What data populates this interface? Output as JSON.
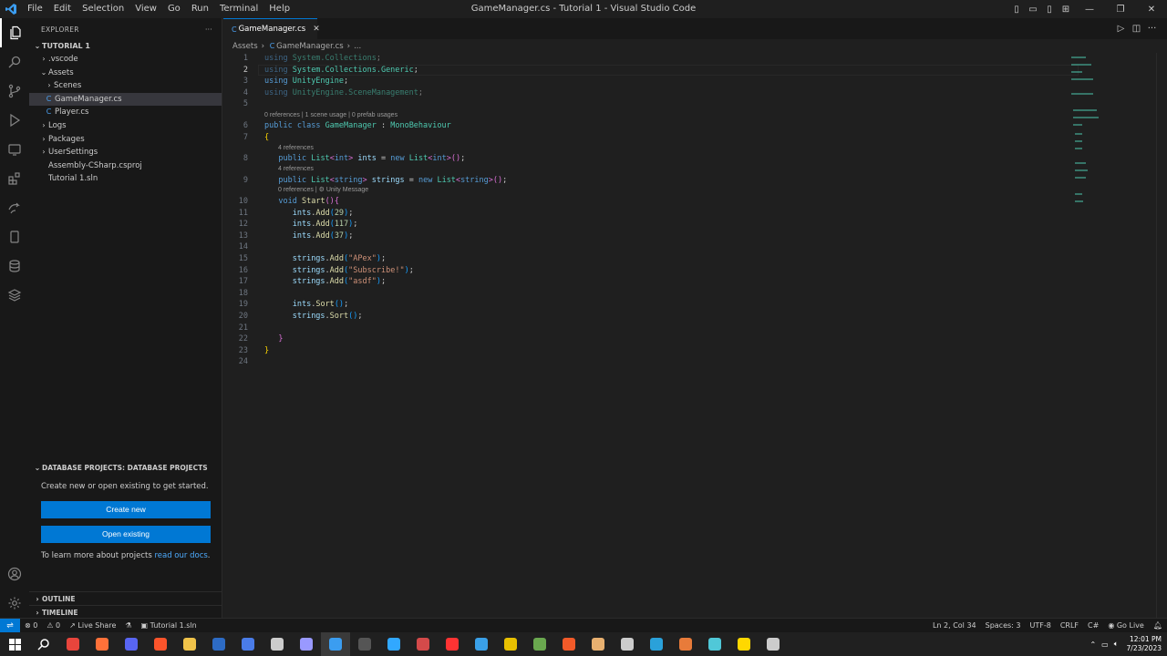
{
  "titlebar": {
    "menu": [
      "File",
      "Edit",
      "Selection",
      "View",
      "Go",
      "Run",
      "Terminal",
      "Help"
    ],
    "title": "GameManager.cs - Tutorial 1 - Visual Studio Code"
  },
  "explorer": {
    "header": "EXPLORER",
    "more": "···",
    "root": "TUTORIAL 1",
    "items": [
      {
        "label": ".vscode",
        "kind": "folder",
        "depth": 1
      },
      {
        "label": "Assets",
        "kind": "folder-open",
        "depth": 1
      },
      {
        "label": "Scenes",
        "kind": "folder",
        "depth": 2
      },
      {
        "label": "GameManager.cs",
        "kind": "cs",
        "depth": 2,
        "selected": true
      },
      {
        "label": "Player.cs",
        "kind": "cs",
        "depth": 2
      },
      {
        "label": "Logs",
        "kind": "folder",
        "depth": 1
      },
      {
        "label": "Packages",
        "kind": "folder",
        "depth": 1
      },
      {
        "label": "UserSettings",
        "kind": "folder",
        "depth": 1
      },
      {
        "label": "Assembly-CSharp.csproj",
        "kind": "file",
        "depth": 1
      },
      {
        "label": "Tutorial 1.sln",
        "kind": "file",
        "depth": 1
      }
    ]
  },
  "dbprojects": {
    "header": "DATABASE PROJECTS: DATABASE PROJECTS",
    "intro": "Create new or open existing to get started.",
    "create_label": "Create new",
    "open_label": "Open existing",
    "docs_prefix": "To learn more about projects ",
    "docs_link": "read our docs",
    "docs_suffix": "."
  },
  "outline_label": "OUTLINE",
  "timeline_label": "TIMELINE",
  "editor": {
    "tab_label": "GameManager.cs",
    "breadcrumb_folder": "Assets",
    "breadcrumb_file": "GameManager.cs",
    "breadcrumb_more": "...",
    "lens": {
      "class": "0 references | 1 scene usage | 0 prefab usages",
      "ints": "4 references",
      "strings": "4 references",
      "start": "0 references | ⚙ Unity Message"
    },
    "line_numbers": [
      "1",
      "2",
      "3",
      "4",
      "5",
      "6",
      "7",
      "8",
      "9",
      "10",
      "11",
      "12",
      "13",
      "14",
      "15",
      "16",
      "17",
      "18",
      "19",
      "20",
      "21",
      "22",
      "23",
      "24"
    ]
  },
  "statusbar": {
    "errors": "⊗ 0",
    "warnings": "⚠ 0",
    "liveshare": "Live Share",
    "solution": "Tutorial 1.sln",
    "position": "Ln 2, Col 34",
    "spaces": "Spaces: 3",
    "encoding": "UTF-8",
    "eol": "CRLF",
    "language": "C#",
    "golive": "Go Live"
  },
  "taskbar": {
    "time": "12:01 PM",
    "date": "7/23/2023",
    "apps": [
      {
        "name": "chrome-icon",
        "color": "#e8453c"
      },
      {
        "name": "firefox-icon",
        "color": "#ff7139"
      },
      {
        "name": "discord-icon",
        "color": "#5865f2"
      },
      {
        "name": "brave-icon",
        "color": "#fb542b"
      },
      {
        "name": "file-explorer-icon",
        "color": "#f0c34a"
      },
      {
        "name": "powershell-icon",
        "color": "#2d6bc4"
      },
      {
        "name": "app-circle-icon",
        "color": "#4a7ce8"
      },
      {
        "name": "unity-icon",
        "color": "#cccccc"
      },
      {
        "name": "premiere-icon",
        "color": "#9999ff"
      },
      {
        "name": "vscode-icon",
        "color": "#3b9df0"
      },
      {
        "name": "obs-icon",
        "color": "#555555"
      },
      {
        "name": "photoshop-icon",
        "color": "#31a8ff"
      },
      {
        "name": "davinci-icon",
        "color": "#d44a4a"
      },
      {
        "name": "illustrator-icon",
        "color": "#ff3333"
      },
      {
        "name": "edge-icon",
        "color": "#3aa0e8"
      },
      {
        "name": "app-yellow-icon",
        "color": "#e8c000"
      },
      {
        "name": "app-green-icon",
        "color": "#6aa84f"
      },
      {
        "name": "app-orange-icon",
        "color": "#f25a29"
      },
      {
        "name": "app-box-icon",
        "color": "#e8b070"
      },
      {
        "name": "settings-icon",
        "color": "#cccccc"
      },
      {
        "name": "telegram-icon",
        "color": "#2aa1da"
      },
      {
        "name": "app-ring-icon",
        "color": "#e87b3a"
      },
      {
        "name": "app-cube-icon",
        "color": "#50c8d8"
      },
      {
        "name": "sticky-notes-icon",
        "color": "#ffd800"
      },
      {
        "name": "app-robot-icon",
        "color": "#cccccc"
      }
    ]
  }
}
